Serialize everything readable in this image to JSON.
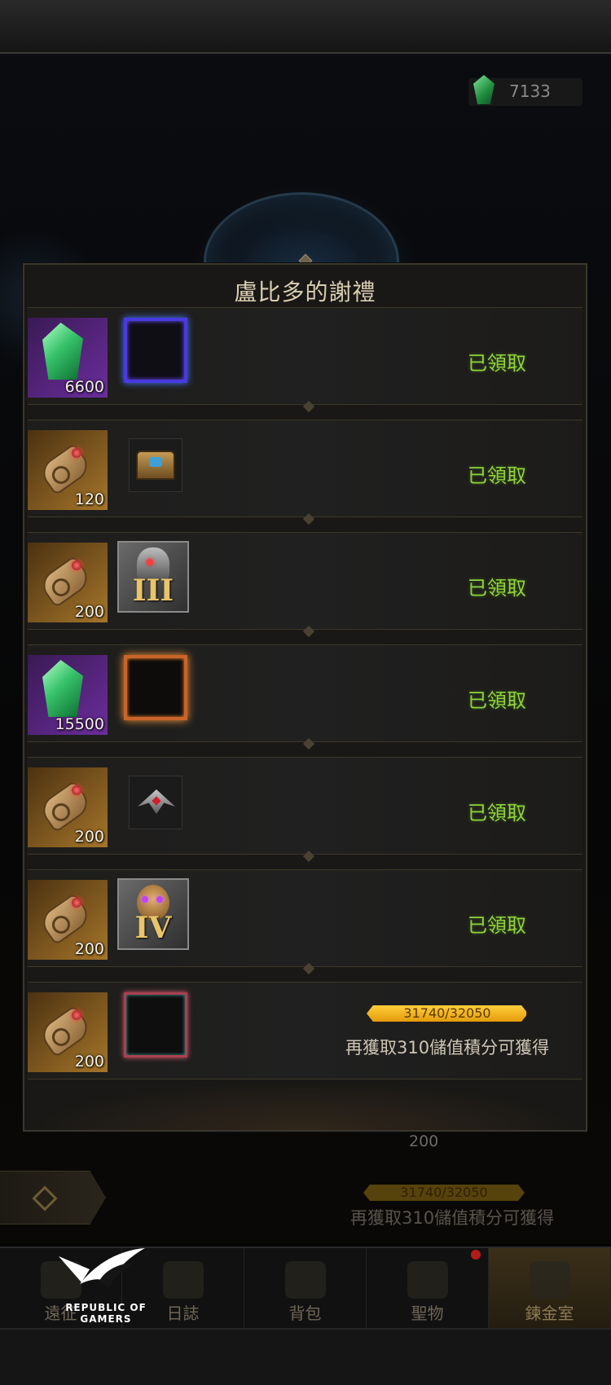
{
  "currency": {
    "icon": "emerald-gem-icon",
    "amount": "7133"
  },
  "popup": {
    "title": "盧比多的謝禮",
    "rewards": [
      {
        "item_icon": "emerald-gem-icon",
        "item_qty": "6600",
        "bonus_icon": "blue-portrait-frame-icon",
        "status": "已領取"
      },
      {
        "item_icon": "scroll-icon",
        "item_qty": "120",
        "bonus_icon": "treasure-chest-icon",
        "status": "已領取"
      },
      {
        "item_icon": "scroll-icon",
        "item_qty": "200",
        "bonus_icon": "knight-helm-emblem-iii-icon",
        "bonus_numeral": "III",
        "status": "已領取"
      },
      {
        "item_icon": "emerald-gem-icon",
        "item_qty": "15500",
        "bonus_icon": "fire-portrait-frame-icon",
        "status": "已領取"
      },
      {
        "item_icon": "scroll-icon",
        "item_qty": "200",
        "bonus_icon": "winged-emblem-icon",
        "status": "已領取"
      },
      {
        "item_icon": "scroll-icon",
        "item_qty": "200",
        "bonus_icon": "bronze-emblem-iv-icon",
        "bonus_numeral": "IV",
        "status": "已領取"
      },
      {
        "item_icon": "scroll-icon",
        "item_qty": "200",
        "bonus_icon": "pink-portrait-frame-icon",
        "progress_text": "31740/32050",
        "progress_value": 0.9903,
        "hint": "再獲取310儲值積分可獲得"
      }
    ]
  },
  "background": {
    "qty": "200",
    "progress_text": "31740/32050",
    "hint": "再獲取310儲值積分可獲得"
  },
  "nav": {
    "items": [
      {
        "label": "遠征",
        "icon": "expedition-icon"
      },
      {
        "label": "日誌",
        "icon": "journal-icon"
      },
      {
        "label": "背包",
        "icon": "backpack-icon"
      },
      {
        "label": "聖物",
        "icon": "relic-icon"
      },
      {
        "label": "鍊金室",
        "icon": "alchemy-icon"
      }
    ]
  },
  "watermark": {
    "line1": "REPUBLIC OF",
    "line2": "GAMERS"
  },
  "colors": {
    "claimed": "#8ed43a",
    "progress": "#f5b417",
    "accent": "#d9ceb2"
  }
}
